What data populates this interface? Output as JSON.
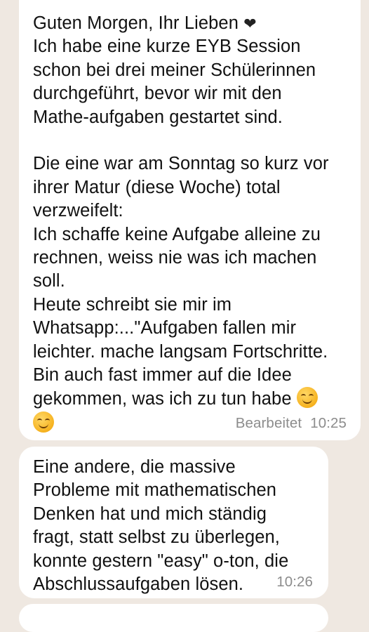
{
  "chat": {
    "messages": [
      {
        "lines": [
          "Guten Morgen, Ihr Lieben",
          "Ich habe eine kurze EYB Session",
          "schon bei drei meiner Schülerinnen",
          "durchgeführt, bevor wir mit den",
          "Mathe-aufgaben gestartet sind.",
          "",
          "Die eine war am Sonntag so kurz vor",
          "ihrer Matur (diese Woche) total",
          "verzweifelt:",
          "Ich schaffe keine Aufgabe alleine zu",
          "rechnen, weiss nie was ich machen",
          "soll.",
          "Heute schreibt sie mir im",
          "Whatsapp:...\"Aufgaben fallen mir",
          "leichter. mache langsam Fortschritte.",
          "Bin auch fast immer auf die Idee",
          "gekommen, was ich zu tun habe"
        ],
        "heart_emoji": "❤",
        "emoji": "smiling-face-with-smiling-eyes",
        "edited_label": "Bearbeitet",
        "time": "10:25"
      },
      {
        "lines": [
          "Eine andere, die massive",
          "Probleme mit mathematischen",
          "Denken hat und mich ständig",
          "fragt, statt selbst zu überlegen,",
          "konnte gestern \"easy\" o-ton, die",
          "Abschlussaufgaben lösen."
        ],
        "time": "10:26"
      }
    ]
  }
}
